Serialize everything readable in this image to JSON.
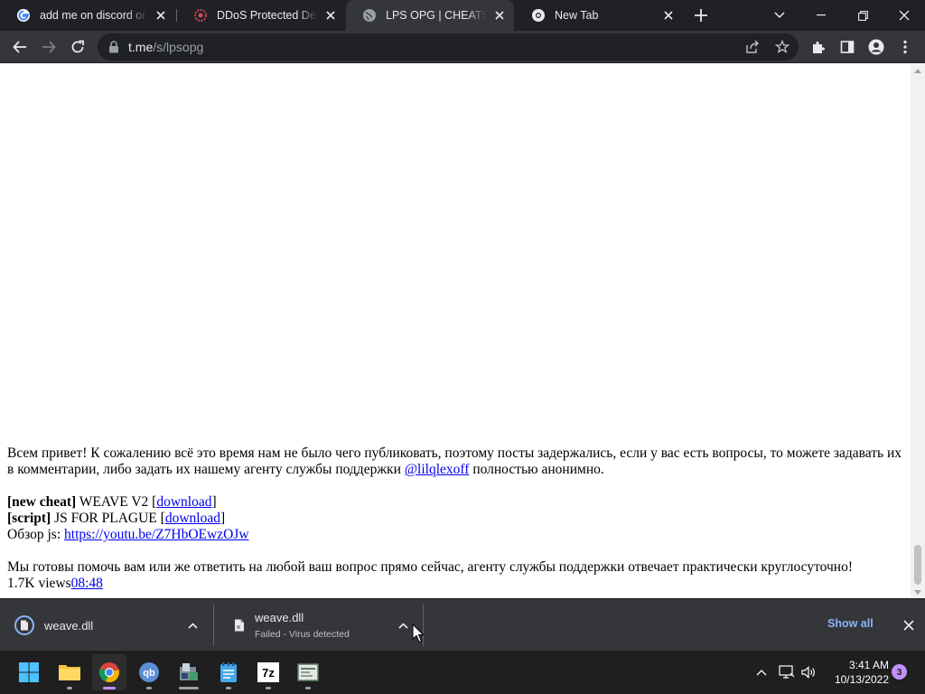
{
  "browser": {
    "tabs": [
      {
        "title": "add me on discord or i",
        "favicon": "google-icon"
      },
      {
        "title": "DDoS Protected Dedica",
        "favicon": "ddos-site-icon"
      },
      {
        "title": "LPS OPG | CHEATS – Te",
        "favicon": "globe-icon",
        "active": true
      },
      {
        "title": "New Tab",
        "favicon": "chrome-icon"
      }
    ],
    "address": {
      "host": "t.me",
      "path": "/s/lpsopg"
    }
  },
  "post": {
    "intro": "Всем привет! К сожалению всё это время нам не было чего публиковать, поэтому посты задержались, если у вас есть вопросы, то можете задавать их в комментарии, либо задать их нашему агенту службы поддержки",
    "support_handle": "@lilqlexoff",
    "intro_tail": "полностью анонимно.",
    "line1_tag": "[new cheat]",
    "line1_text": "WEAVE V2 [",
    "line1_link": "download",
    "line1_end": "]",
    "line2_tag": "[script]",
    "line2_text": "JS FOR PLAGUE [",
    "line2_link": "download",
    "line2_end": "]",
    "review_label": "Обзор js:",
    "review_link": "https://youtu.be/Z7HbOEwzOJw",
    "closing": "Мы готовы помочь вам или же ответить на любой ваш вопрос прямо сейчас, агенту службы поддержки отвечает практически круглосуточно!",
    "views": "1.7K views",
    "time": "08:48"
  },
  "downloads": {
    "items": [
      {
        "name": "weave.dll",
        "status": ""
      },
      {
        "name": "weave.dll",
        "status": "Failed - Virus detected"
      }
    ],
    "show_all": "Show all"
  },
  "taskbar": {
    "apps": [
      "start-icon",
      "file-explorer-icon",
      "chrome-icon",
      "qbittorrent-icon",
      "app-icon",
      "notepad-icon",
      "7zip-icon",
      "app-window-icon"
    ],
    "time": "3:41 AM",
    "date": "10/13/2022",
    "notification_count": "3"
  },
  "colors": {
    "tab_strip": "#202124",
    "toolbar": "#35363a",
    "link": "#0000ee",
    "show_all": "#8ab4f8",
    "accent": "#c390f9"
  }
}
